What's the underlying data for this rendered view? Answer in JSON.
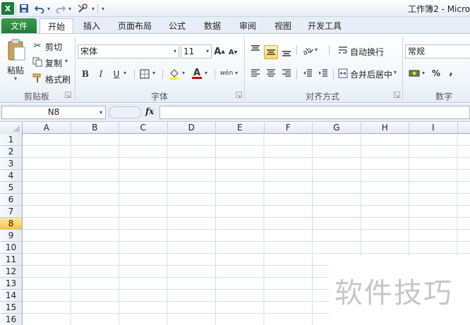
{
  "window": {
    "title": "工作簿2 - Micro",
    "app_icon_letter": "X"
  },
  "quick_access": {
    "save_icon": "save-icon",
    "undo_icon": "undo-icon",
    "redo_icon": "redo-icon",
    "tool_icon": "tool-icon"
  },
  "tabs": [
    {
      "label": "文件"
    },
    {
      "label": "开始"
    },
    {
      "label": "插入"
    },
    {
      "label": "页面布局"
    },
    {
      "label": "公式"
    },
    {
      "label": "数据"
    },
    {
      "label": "审阅"
    },
    {
      "label": "视图"
    },
    {
      "label": "开发工具"
    }
  ],
  "ribbon": {
    "clipboard": {
      "paste": "粘贴",
      "cut": "剪切",
      "copy": "复制",
      "format_painter": "格式刷",
      "group": "剪贴板"
    },
    "font": {
      "name": "宋体",
      "size": "11",
      "bold": "B",
      "italic": "I",
      "underline": "U",
      "grow": "A",
      "shrink": "A",
      "group": "字体",
      "fill_color": "#ffff00",
      "font_color": "#d00000",
      "wen": "wén"
    },
    "alignment": {
      "wrap": "自动换行",
      "merge": "合并后居中",
      "group": "对齐方式"
    },
    "number": {
      "format": "常规",
      "percent": "%",
      "comma": ",",
      "group": "数字"
    }
  },
  "formula_bar": {
    "name_box": "N8",
    "fx": "fx",
    "value": ""
  },
  "columns": [
    "A",
    "B",
    "C",
    "D",
    "E",
    "F",
    "G",
    "H",
    "I"
  ],
  "rows": [
    "1",
    "2",
    "3",
    "4",
    "5",
    "6",
    "7",
    "8",
    "9",
    "10",
    "11",
    "12",
    "13",
    "14",
    "15",
    "16"
  ],
  "selected_row": "8",
  "watermark": "软件技巧"
}
